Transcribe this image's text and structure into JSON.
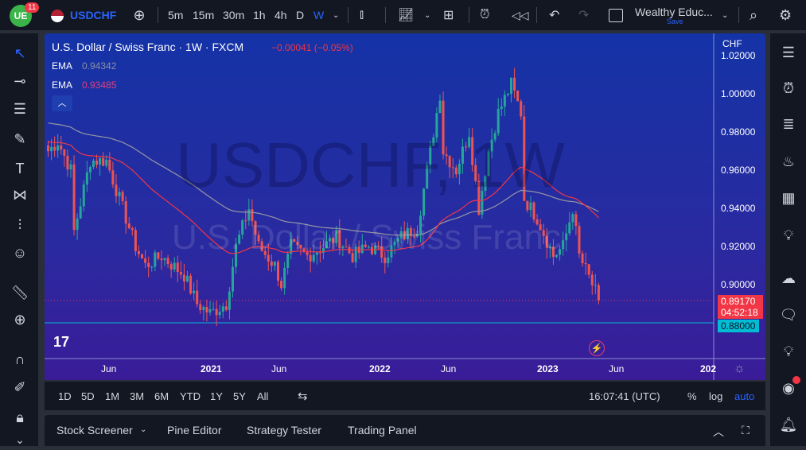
{
  "topbar": {
    "notif_count": "11",
    "symbol": "USDCHF",
    "intervals": [
      "5m",
      "15m",
      "30m",
      "1h",
      "4h",
      "D",
      "W"
    ],
    "active_interval": "W",
    "layout_name": "Wealthy Educ...",
    "save_label": "Save"
  },
  "legend": {
    "title": "U.S. Dollar / Swiss Franc · 1W · FXCM",
    "change": "−0.00041 (−0.05%)",
    "ema1_label": "EMA",
    "ema1_value": "0.94342",
    "ema2_label": "EMA",
    "ema2_value": "0.93485"
  },
  "watermark": {
    "symbol": "USDCHF, 1W",
    "name": "U.S. Dollar / Swiss Franc"
  },
  "price_axis": {
    "currency": "CHF",
    "ticks": [
      "1.02000",
      "1.00000",
      "0.98000",
      "0.96000",
      "0.94000",
      "0.92000",
      "0.90000"
    ],
    "last_price": "0.89170",
    "countdown": "04:52:18",
    "hline_price": "0.88000"
  },
  "time_axis": [
    "Jun",
    "2021",
    "Jun",
    "2022",
    "Jun",
    "2023",
    "Jun",
    "202"
  ],
  "bottom_toolbar": {
    "ranges": [
      "1D",
      "5D",
      "1M",
      "3M",
      "6M",
      "YTD",
      "1Y",
      "5Y",
      "All"
    ],
    "clock": "16:07:41 (UTC)",
    "percent": "%",
    "log": "log",
    "auto": "auto"
  },
  "tabs": [
    "Stock Screener",
    "Pine Editor",
    "Strategy Tester",
    "Trading Panel"
  ],
  "colors": {
    "up": "#26a69a",
    "down": "#ef5350",
    "ema_fast": "#f23645",
    "ema_slow": "#9598a1",
    "accent": "#2962ff"
  },
  "chart_data": {
    "type": "candlestick",
    "title": "USDCHF 1W",
    "ylim": [
      0.872,
      1.025
    ],
    "anchors": [
      [
        0,
        0.97
      ],
      [
        3,
        0.975
      ],
      [
        7,
        0.96
      ],
      [
        8,
        0.928
      ],
      [
        13,
        0.965
      ],
      [
        18,
        0.965
      ],
      [
        23,
        0.94
      ],
      [
        27,
        0.92
      ],
      [
        30,
        0.91
      ],
      [
        35,
        0.915
      ],
      [
        42,
        0.905
      ],
      [
        46,
        0.89
      ],
      [
        50,
        0.885
      ],
      [
        55,
        0.89
      ],
      [
        58,
        0.92
      ],
      [
        62,
        0.94
      ],
      [
        65,
        0.92
      ],
      [
        70,
        0.91
      ],
      [
        72,
        0.9
      ],
      [
        75,
        0.92
      ],
      [
        80,
        0.915
      ],
      [
        85,
        0.92
      ],
      [
        89,
        0.925
      ],
      [
        94,
        0.915
      ],
      [
        99,
        0.92
      ],
      [
        104,
        0.915
      ],
      [
        109,
        0.925
      ],
      [
        114,
        0.93
      ],
      [
        117,
        0.96
      ],
      [
        121,
        1.0
      ],
      [
        122,
        0.97
      ],
      [
        126,
        0.96
      ],
      [
        130,
        0.98
      ],
      [
        133,
        0.94
      ],
      [
        136,
        0.97
      ],
      [
        139,
        0.99
      ],
      [
        143,
        1.005
      ],
      [
        146,
        0.99
      ],
      [
        147,
        0.945
      ],
      [
        151,
        0.935
      ],
      [
        156,
        0.915
      ],
      [
        159,
        0.92
      ],
      [
        162,
        0.94
      ],
      [
        164,
        0.915
      ],
      [
        168,
        0.9
      ],
      [
        170,
        0.892
      ]
    ]
  }
}
